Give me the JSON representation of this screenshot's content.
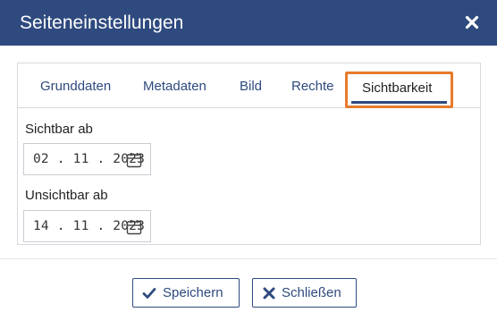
{
  "dialog": {
    "title": "Seiteneinstellungen",
    "close_icon": "close-icon"
  },
  "tabs": [
    {
      "label": "Grunddaten",
      "active": false
    },
    {
      "label": "Metadaten",
      "active": false
    },
    {
      "label": "Bild",
      "active": false
    },
    {
      "label": "Rechte",
      "active": false
    },
    {
      "label": "Sichtbarkeit",
      "active": true
    }
  ],
  "visibility": {
    "visible_from_label": "Sichtbar ab",
    "visible_from_value": "02.11.2023",
    "invisible_from_label": "Unsichtbar ab",
    "invisible_from_value": "14.11.2023",
    "calendar_icon": "calendar-icon"
  },
  "footer": {
    "save_label": "Speichern",
    "save_icon": "check-icon",
    "close_label": "Schließen",
    "close_icon": "x-icon"
  },
  "colors": {
    "header": "#2e4a7e",
    "active_highlight": "#e87a2a",
    "primary_text": "#2e4a7e"
  }
}
